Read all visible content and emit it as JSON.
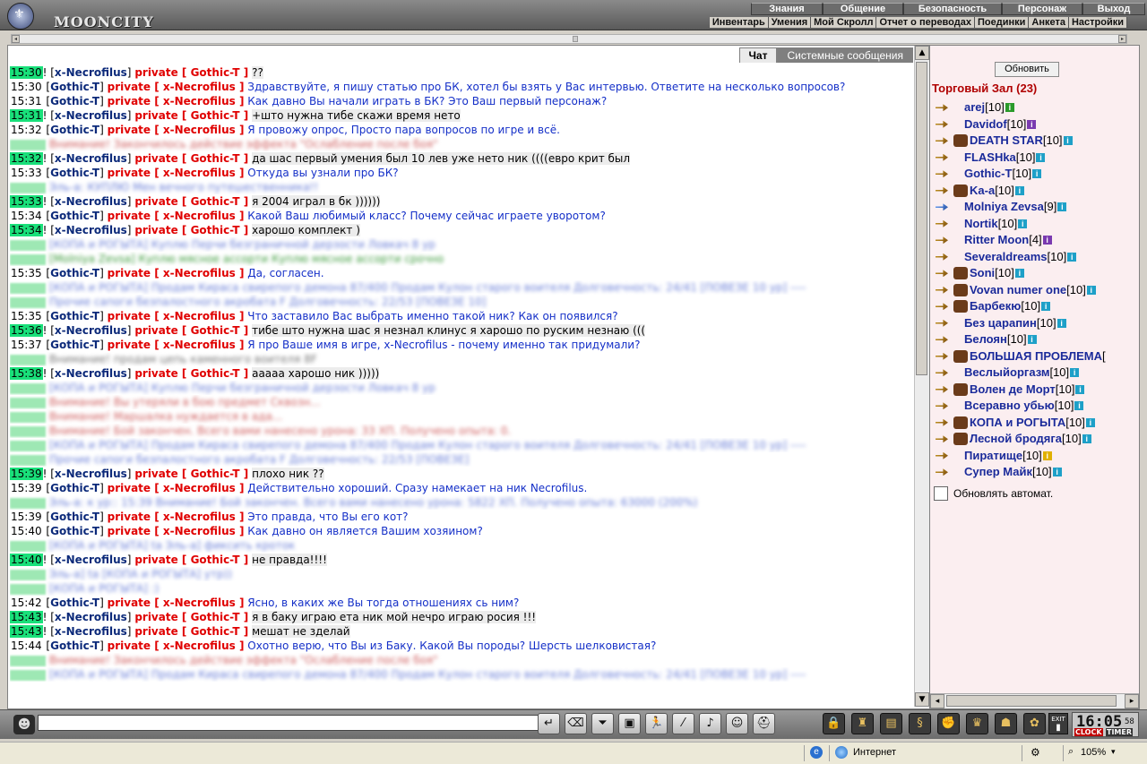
{
  "app": {
    "title": "MOONCITY"
  },
  "menu_top": [
    "Знания",
    "Общение",
    "Безопасность",
    "Персонаж",
    "Выход"
  ],
  "menu_sub": [
    "Инвентарь",
    "Умения",
    "Мой Скролл",
    "Отчет о переводах",
    "Поединки",
    "Анкета",
    "Настройки"
  ],
  "chat_tabs": {
    "chat": "Чат",
    "system": "Системные сообщения"
  },
  "chat_lines": [
    {
      "kind": "priv",
      "ts": "15:30",
      "green": true,
      "excl": true,
      "from": "x-Necrofilus",
      "to": "Gothic-T",
      "text": "??",
      "msg_style": "black"
    },
    {
      "kind": "priv",
      "ts": "15:30",
      "green": false,
      "excl": false,
      "from": "Gothic-T",
      "to": "x-Necrofilus",
      "text": "Здравствуйте, я пишу статью про БК, хотел бы взять у Вас интервью. Ответите на несколько вопросов?",
      "msg_style": "blue",
      "wrap": true
    },
    {
      "kind": "priv",
      "ts": "15:31",
      "green": false,
      "excl": false,
      "from": "Gothic-T",
      "to": "x-Necrofilus",
      "text": "Как давно Вы начали играть в БК? Это Ваш первый персонаж?",
      "msg_style": "blue"
    },
    {
      "kind": "priv",
      "ts": "15:31",
      "green": true,
      "excl": true,
      "from": "x-Necrofilus",
      "to": "Gothic-T",
      "text": "+што нужна тибе скажи время нето",
      "msg_style": "black"
    },
    {
      "kind": "priv",
      "ts": "15:32",
      "green": false,
      "excl": false,
      "from": "Gothic-T",
      "to": "x-Necrofilus",
      "text": "Я провожу опрос, Просто пара вопросов по игре и всё.",
      "msg_style": "blue"
    },
    {
      "kind": "blur",
      "style": "red",
      "text": "Внимание! Закончилось действие эффекта \"Ослабление после боя\""
    },
    {
      "kind": "priv",
      "ts": "15:32",
      "green": true,
      "excl": true,
      "from": "x-Necrofilus",
      "to": "Gothic-T",
      "text": "да шас первый умения был 10 лев уже нето ник ((((евро крит был",
      "msg_style": "black"
    },
    {
      "kind": "priv",
      "ts": "15:33",
      "green": false,
      "excl": false,
      "from": "Gothic-T",
      "to": "x-Necrofilus",
      "text": "Откуда вы узнали про БК?",
      "msg_style": "blue"
    },
    {
      "kind": "blur",
      "style": "blue",
      "text": "Эль-а: КУПЛЮ Мен вечного путешественника!!"
    },
    {
      "kind": "priv",
      "ts": "15:33",
      "green": true,
      "excl": true,
      "from": "x-Necrofilus",
      "to": "Gothic-T",
      "text": "я 2004 играл в бк ))))))",
      "msg_style": "black"
    },
    {
      "kind": "priv",
      "ts": "15:34",
      "green": false,
      "excl": false,
      "from": "Gothic-T",
      "to": "x-Necrofilus",
      "text": "Какой Ваш любимый класс? Почему сейчас играете уворотом?",
      "msg_style": "blue"
    },
    {
      "kind": "priv",
      "ts": "15:34",
      "green": true,
      "excl": true,
      "from": "x-Necrofilus",
      "to": "Gothic-T",
      "text": "харошо комплект )",
      "msg_style": "black"
    },
    {
      "kind": "blur",
      "style": "blue",
      "text": "[КОПА и РОГЫТА] Куплю Перчи безграничной дерзости Ловкач 8 ур"
    },
    {
      "kind": "blur",
      "style": "green",
      "text": "[Molniya Zevsa] Куплю мясное ассорти   Куплю мясное ассорти срочно"
    },
    {
      "kind": "priv",
      "ts": "15:35",
      "green": false,
      "excl": false,
      "from": "Gothic-T",
      "to": "x-Necrofilus",
      "text": "Да, согласен.",
      "msg_style": "blue"
    },
    {
      "kind": "blur",
      "style": "blue",
      "text": "[КОПА и РОГЫТА] Продам Кираса свирепого демона 87/400 Продам Кулон старого воителя Долговечность: 24/41 [ПОВЕЗЕ 10 ур] ----"
    },
    {
      "kind": "blur",
      "style": "blue",
      "text": "Прочие сапоги безпалостного акробата F Долговечность: 22/53 [ПОВЕЗЕ 10]"
    },
    {
      "kind": "priv",
      "ts": "15:35",
      "green": false,
      "excl": false,
      "from": "Gothic-T",
      "to": "x-Necrofilus",
      "text": "Что заставило Вас выбрать именно такой ник? Как он появился?",
      "msg_style": "blue"
    },
    {
      "kind": "priv",
      "ts": "15:36",
      "green": true,
      "excl": true,
      "from": "x-Necrofilus",
      "to": "Gothic-T",
      "text": "тибе што нужна шас я незнал клинус я харошо по руским незнаю (((",
      "msg_style": "black"
    },
    {
      "kind": "priv",
      "ts": "15:37",
      "green": false,
      "excl": false,
      "from": "Gothic-T",
      "to": "x-Necrofilus",
      "text": "Я про Ваше имя в игре, x-Necrofilus - почему именно так придумали?",
      "msg_style": "blue"
    },
    {
      "kind": "blur",
      "style": "gray",
      "text": "Внимание! продам цепь каменного воителя 8F"
    },
    {
      "kind": "priv",
      "ts": "15:38",
      "green": true,
      "excl": true,
      "from": "x-Necrofilus",
      "to": "Gothic-T",
      "text": "ааааа харошо ник )))))",
      "msg_style": "black"
    },
    {
      "kind": "blur",
      "style": "blue",
      "text": "[КОПА и РОГЫТА] Куплю Перчи безграничной дерзости Ловкач 8 ур"
    },
    {
      "kind": "blur",
      "style": "red",
      "text": "Внимание! Вы утеряли в бою предмет Сквозн..."
    },
    {
      "kind": "blur",
      "style": "red",
      "text": "Внимание! Маршалка нуждается в ада..."
    },
    {
      "kind": "blur",
      "style": "red",
      "text": "Внимание! Бой закончен. Всего вами нанесено урона: 33 ХП. Получено опыта: 0."
    },
    {
      "kind": "blur",
      "style": "blue",
      "text": "[КОПА и РОГЫТА] Продам Кираса свирепого демона 87/400 Продам Кулон старого воителя Долговечность: 24/41 [ПОВЕЗЕ 10 ур] ----"
    },
    {
      "kind": "blur",
      "style": "blue",
      "text": "Прочие сапоги безпалостного акробата F Долговечность: 22/53 [ПОВЕЗЕ]"
    },
    {
      "kind": "priv",
      "ts": "15:39",
      "green": true,
      "excl": true,
      "from": "x-Necrofilus",
      "to": "Gothic-T",
      "text": "плохо ник ??",
      "msg_style": "black"
    },
    {
      "kind": "priv",
      "ts": "15:39",
      "green": false,
      "excl": false,
      "from": "Gothic-T",
      "to": "x-Necrofilus",
      "text": "Действительно хороший. Сразу намекает на ник Necrofilus.",
      "msg_style": "blue"
    },
    {
      "kind": "blur",
      "style": "blue",
      "text": "Эль-а: к ур:: 15:39 Внимание! Бой закончен. Всего вами нанесено урона: 5822 ХП. Получено опыта: 63000 (200%)"
    },
    {
      "kind": "priv",
      "ts": "15:39",
      "green": false,
      "excl": false,
      "from": "Gothic-T",
      "to": "x-Necrofilus",
      "text": "Это правда, что Вы его кот?",
      "msg_style": "blue"
    },
    {
      "kind": "priv",
      "ts": "15:40",
      "green": false,
      "excl": false,
      "from": "Gothic-T",
      "to": "x-Necrofilus",
      "text": "Как давно он является Вашим хозяином?",
      "msg_style": "blue"
    },
    {
      "kind": "blur",
      "style": "blue",
      "text": "[КОПА и РОГЫТА] ta Эль-а] фиксить кроток"
    },
    {
      "kind": "priv",
      "ts": "15:40",
      "green": true,
      "excl": true,
      "from": "x-Necrofilus",
      "to": "Gothic-T",
      "text": "не правда!!!!",
      "msg_style": "black"
    },
    {
      "kind": "blur",
      "style": "blue",
      "text": "Эль-а] ta [КОПА и РОГЫТА] утр))"
    },
    {
      "kind": "blur",
      "style": "blue",
      "text": "[КОПА и РОГЫТА] :)"
    },
    {
      "kind": "priv",
      "ts": "15:42",
      "green": false,
      "excl": false,
      "from": "Gothic-T",
      "to": "x-Necrofilus",
      "text": "Ясно, в каких же Вы тогда отношениях сь ним?",
      "msg_style": "blue"
    },
    {
      "kind": "priv",
      "ts": "15:43",
      "green": true,
      "excl": true,
      "from": "x-Necrofilus",
      "to": "Gothic-T",
      "text": "я в баку играю ета ник мой нечро играю росия !!!",
      "msg_style": "black"
    },
    {
      "kind": "priv",
      "ts": "15:43",
      "green": true,
      "excl": true,
      "from": "x-Necrofilus",
      "to": "Gothic-T",
      "text": "мешат не зделай",
      "msg_style": "black"
    },
    {
      "kind": "priv",
      "ts": "15:44",
      "green": false,
      "excl": false,
      "from": "Gothic-T",
      "to": "x-Necrofilus",
      "text": "Охотно верю, что Вы из Баку. Какой Вы породы? Шерсть шелковистая?",
      "msg_style": "blue"
    },
    {
      "kind": "blur",
      "style": "red",
      "text": "Внимание! Закончилось действие эффекта \"Ослабление после боя\""
    },
    {
      "kind": "blur",
      "style": "blue",
      "text": "[КОПА и РОГЫТА] Продам Кираса свирепого демона 87/400 Продам Кулон старого воителя Долговечность: 24/41 [ПОВЕЗЕ 10 ур] ----"
    }
  ],
  "right_panel": {
    "refresh_label": "Обновить",
    "room_title": "Торговый Зал (23)",
    "auto_refresh_label": "Обновлять автомат."
  },
  "users": [
    {
      "name": "arej",
      "level": "[10]",
      "info": "green",
      "badge": false
    },
    {
      "name": "Davidof",
      "level": "[10]",
      "info": "purple",
      "badge": false
    },
    {
      "name": "DEATH STAR",
      "level": "[10]",
      "info": "blue",
      "badge": true
    },
    {
      "name": "FLASHka",
      "level": "[10]",
      "info": "blue",
      "badge": false
    },
    {
      "name": "Gothic-T",
      "level": "[10]",
      "info": "blue",
      "badge": false
    },
    {
      "name": "Ka-a",
      "level": "[10]",
      "info": "blue",
      "badge": true
    },
    {
      "name": "Molniya Zevsa",
      "level": "[9]",
      "info": "blue",
      "badge": false,
      "blue_icon": true
    },
    {
      "name": "Nortik",
      "level": "[10]",
      "info": "blue",
      "badge": false
    },
    {
      "name": "Ritter Moon",
      "level": "[4]",
      "info": "purple",
      "badge": false
    },
    {
      "name": "Severaldreams",
      "level": "[10]",
      "info": "blue",
      "badge": false
    },
    {
      "name": "Soni",
      "level": "[10]",
      "info": "blue",
      "badge": true
    },
    {
      "name": "Vovan numer one",
      "level": "[10]",
      "info": "blue",
      "badge": true
    },
    {
      "name": "Барбекю",
      "level": "[10]",
      "info": "blue",
      "badge": true
    },
    {
      "name": "Без царапин",
      "level": "[10]",
      "info": "blue",
      "badge": false
    },
    {
      "name": "Белоян",
      "level": "[10]",
      "info": "blue",
      "badge": false
    },
    {
      "name": "БОЛЬШАЯ ПРОБЛЕМА",
      "level": "[",
      "info": "",
      "badge": true
    },
    {
      "name": "Веслыйоргазм",
      "level": "[10]",
      "info": "blue",
      "badge": false
    },
    {
      "name": "Волен де Морт",
      "level": "[10]",
      "info": "blue",
      "badge": true
    },
    {
      "name": "Всеравно убью",
      "level": "[10]",
      "info": "blue",
      "badge": false
    },
    {
      "name": "КОПА и РОГЫТА",
      "level": "[10]",
      "info": "blue",
      "badge": true
    },
    {
      "name": "Лесной бродяга",
      "level": "[10]",
      "info": "blue",
      "badge": true
    },
    {
      "name": "Пиратище",
      "level": "[10]",
      "info": "yellow",
      "badge": false
    },
    {
      "name": "Супер Майк",
      "level": "[10]",
      "info": "blue",
      "badge": false
    }
  ],
  "bottom": {
    "input_value": "",
    "clock_time": "16:05",
    "clock_sec": "58",
    "clock_label": "CLOCK",
    "timer_label": "TIMER",
    "exit_label": "EXIT"
  },
  "status_bar": {
    "zone": "Интернет",
    "zoom": "105%"
  },
  "colors": {
    "timestamp_green": "#19e07a",
    "private": "#e00000",
    "nick": "#0c2a7a",
    "message": "#1530c8",
    "room_title": "#b00000"
  }
}
